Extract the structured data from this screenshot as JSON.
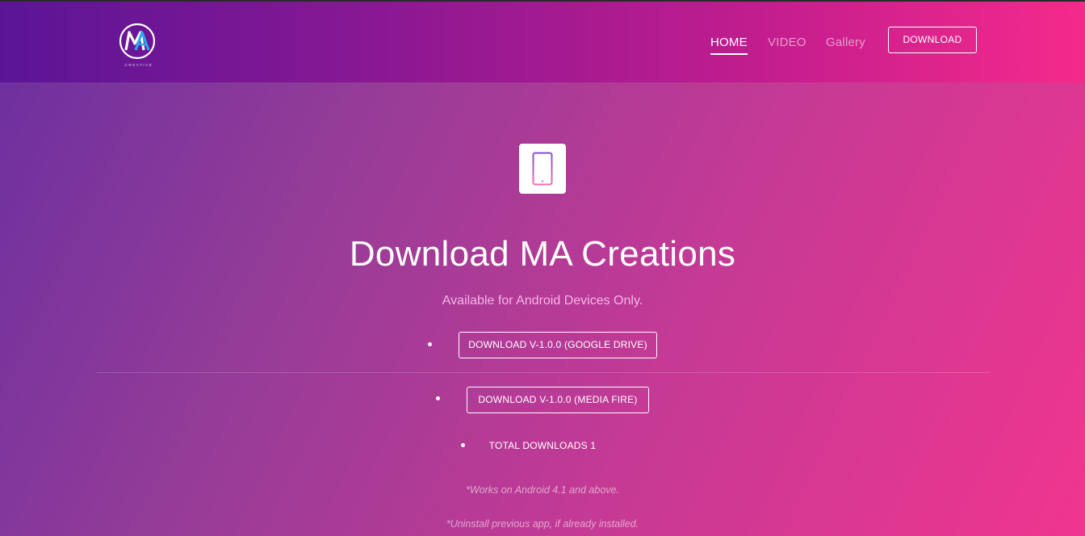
{
  "header": {
    "logo_icon": "ma-creative-logo",
    "logo_letters": "MA",
    "logo_tagline": "CREATIVE",
    "nav": {
      "home": "HOME",
      "video": "VIDEO",
      "gallery": "Gallery"
    },
    "download_button": "DOWNLOAD"
  },
  "hero": {
    "icon": "phone-icon",
    "title": "Download MA Creations",
    "subtitle": "Available for Android Devices Only.",
    "buttons": {
      "google_drive": "DOWNLOAD V-1.0.0 (GOOGLE DRIVE)",
      "media_fire": "DOWNLOAD V-1.0.0 (MEDIA FIRE)"
    },
    "total_downloads": "TOTAL DOWNLOADS 1",
    "notes": [
      "*Works on Android 4.1 and above.",
      "*Uninstall previous app, if already installed."
    ]
  },
  "colors": {
    "header_start": "#5a1596",
    "header_end": "#f52a8b",
    "body_start": "#6a2fa0",
    "body_end": "#f0358f",
    "subtitle": "#f4b6e6"
  }
}
